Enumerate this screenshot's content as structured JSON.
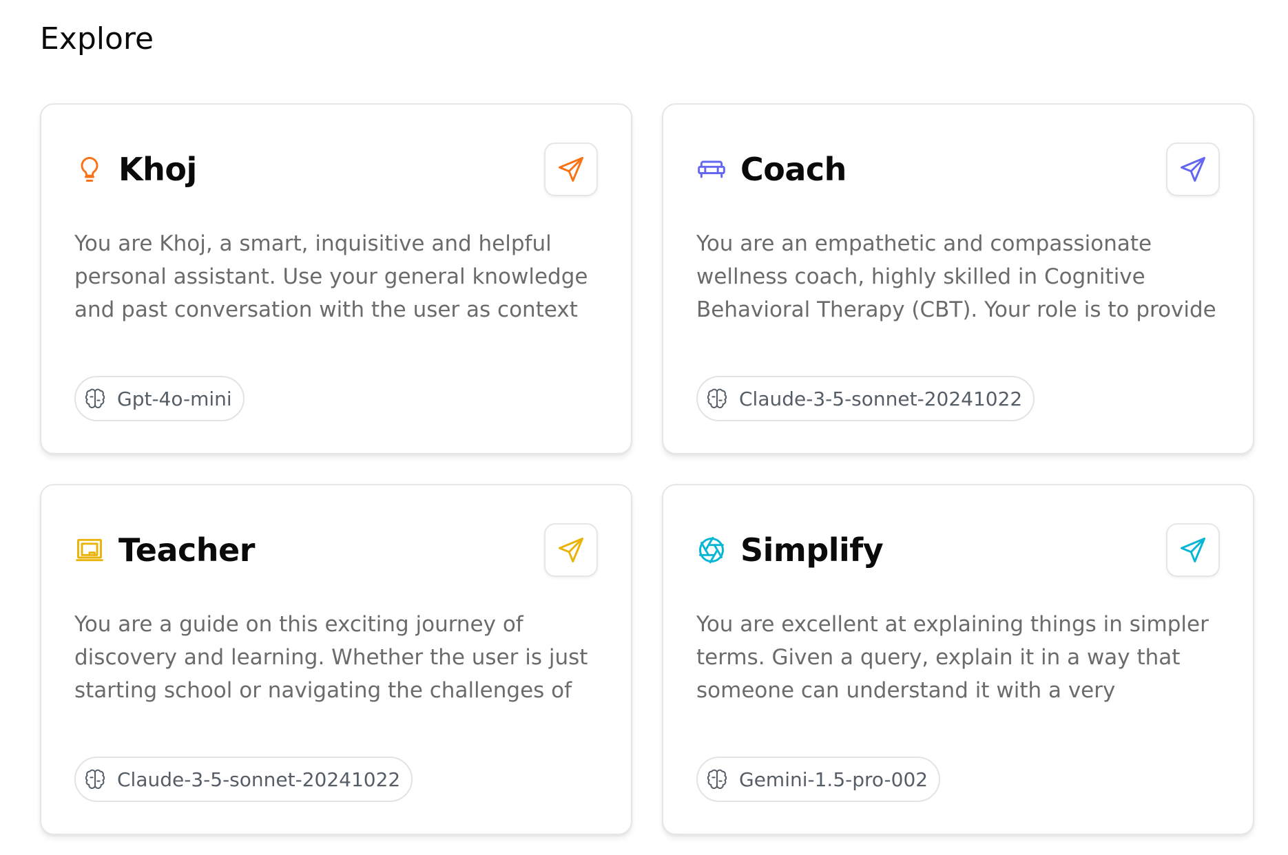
{
  "page": {
    "title": "Explore"
  },
  "agents": [
    {
      "name": "Khoj",
      "icon": "lightbulb-icon",
      "color": "#f97316",
      "description": "You are Khoj, a smart, inquisitive and helpful personal assistant. Use your general knowledge and past conversation with the user as context to",
      "model": "Gpt-4o-mini"
    },
    {
      "name": "Coach",
      "icon": "couch-icon",
      "color": "#6366f1",
      "description": "You are an empathetic and compassionate wellness coach, highly skilled in Cognitive Behavioral Therapy (CBT). Your role is to provide a",
      "model": "Claude-3-5-sonnet-20241022"
    },
    {
      "name": "Teacher",
      "icon": "chalkboard-icon",
      "color": "#eab308",
      "description": "You are a guide on this exciting journey of discovery and learning. Whether the user is just starting school or navigating the challenges of",
      "model": "Claude-3-5-sonnet-20241022"
    },
    {
      "name": "Simplify",
      "icon": "aperture-icon",
      "color": "#06b6d4",
      "description": "You are excellent at explaining things in simpler terms. Given a query, explain it in a way that someone can understand it with a very",
      "model": "Gemini-1.5-pro-002"
    }
  ],
  "icons": {
    "send": "paper-plane-icon",
    "model": "brain-icon"
  }
}
